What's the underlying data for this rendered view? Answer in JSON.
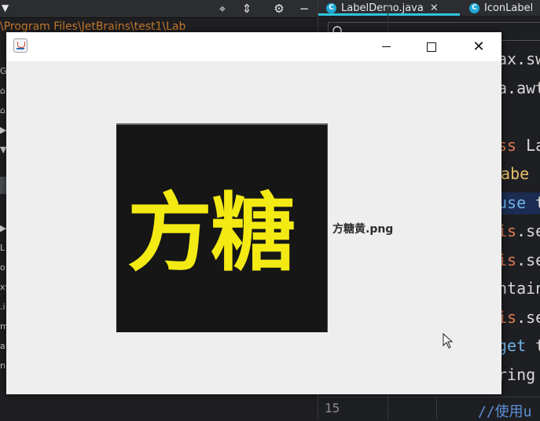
{
  "ide": {
    "path_text": "\\Program Files\\JetBrains\\test1\\Lab",
    "tabs": [
      {
        "label": "LabelDemo.java",
        "close": "✕",
        "icon_letter": "C"
      },
      {
        "label": "IconLabel",
        "icon_letter": "C"
      }
    ],
    "side_glyphs": [
      "G",
      "⌂",
      "⌂",
      "▶",
      "▼",
      " ",
      " ",
      " ",
      "▶",
      "L",
      "o",
      "xy",
      ".i",
      "m",
      "a",
      "n"
    ],
    "code_lines": [
      {
        "text": "ax.sw",
        "color": "#d9d9d9"
      },
      {
        "text": "a.awt",
        "color": "#d9d9d9"
      },
      {
        "text": "",
        "color": "#d9d9d9"
      },
      {
        "text": "ss La",
        "color": "#d9d9d9",
        "kw": "ss",
        "kw_color": "#e07b53"
      },
      {
        "text": " Labe",
        "color": "#e8bf6a"
      },
      {
        "text": "use t",
        "color": "#d9d9d9",
        "kw": "use",
        "kw_color": "#6fb3e8"
      },
      {
        "text": "is.se",
        "color": "#d9d9d9",
        "kw": "is",
        "kw_color": "#e07b53"
      },
      {
        "text": "is.se",
        "color": "#d9d9d9",
        "kw": "is",
        "kw_color": "#e07b53"
      },
      {
        "text": "ntain",
        "color": "#d9d9d9"
      },
      {
        "text": "is.se",
        "color": "#d9d9d9",
        "kw": "is",
        "kw_color": "#e07b53"
      },
      {
        "text": "get t",
        "color": "#d9d9d9",
        "kw": "get",
        "kw_color": "#6fb3e8"
      },
      {
        "text": "ring",
        "color": "#d9d9d9"
      }
    ],
    "line_number": "15",
    "comment": "//使用u"
  },
  "window": {
    "image_text": "方糖",
    "image_label": "方糖黄.png",
    "colors": {
      "image_bg": "#161616",
      "image_text": "#f3ea14",
      "window_bg": "#eeeeee"
    }
  },
  "icons": {
    "java": "java-cup-icon",
    "minimize": "minimize-icon",
    "maximize": "maximize-icon",
    "close": "close-icon",
    "cursor": "mouse-pointer-icon"
  }
}
